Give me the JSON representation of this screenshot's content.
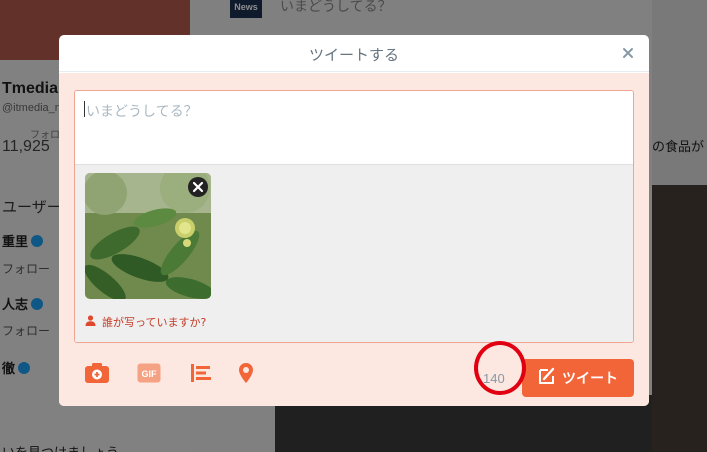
{
  "background": {
    "news_badge": "News",
    "timeline_prompt": "いまどうしてる？",
    "profile_name": "Tmedia",
    "profile_handle": "@itmedia_n",
    "followers_label": "フォロー",
    "followers_count": "11,925",
    "section_title": "ユーザー",
    "users": [
      {
        "name": "重里",
        "action": "フォロー"
      },
      {
        "name": "人志",
        "action": "フォロー"
      },
      {
        "name": "徹",
        "action": ""
      }
    ],
    "tweet_snippet": "の食品が",
    "find_people": "いを見つけましょう"
  },
  "modal": {
    "title": "ツイートする",
    "close_icon": "close-icon"
  },
  "composer": {
    "placeholder": "いまどうしてる？",
    "tag_people": "誰が写っていますか?",
    "media_alt": "chestnut tree photo"
  },
  "toolbar": {
    "icons": [
      "camera-icon",
      "gif-icon",
      "poll-icon",
      "location-icon"
    ],
    "gif_label": "GIF",
    "char_count": "140",
    "tweet_button": "ツイート"
  },
  "colors": {
    "accent": "#f26538",
    "body_bg": "#fde7e1",
    "icon": "#f26538",
    "annotation": "#e00012"
  }
}
